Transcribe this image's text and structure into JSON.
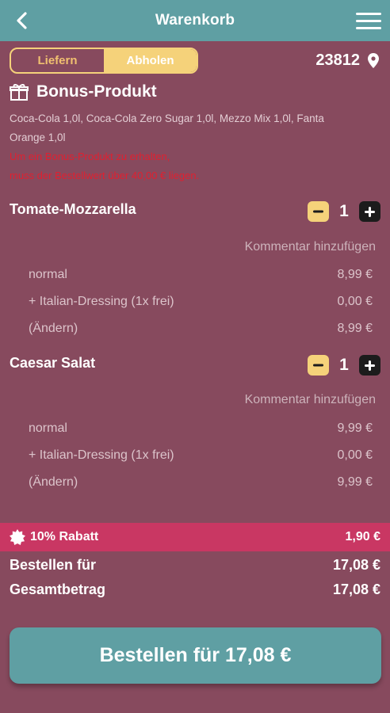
{
  "header": {
    "title": "Warenkorb",
    "back_icon": "chevron-left-icon",
    "menu_icon": "hamburger-menu-icon"
  },
  "delivery_toggle": {
    "options": [
      "Liefern",
      "Abholen"
    ],
    "selected": "Abholen",
    "active_color": "#f5d27a"
  },
  "location": {
    "zip": "23812",
    "icon": "map-pin-icon"
  },
  "bonus": {
    "title": "Bonus-Produkt",
    "icon": "gift-icon",
    "products": "Coca-Cola 1,0l, Coca-Cola Zero Sugar 1,0l, Mezzo Mix 1,0l, Fanta Orange 1,0l",
    "hint_line1": "Um ein Bonus-Produkt zu erhalten,",
    "hint_line2": "muss der Bestellwert über 40,00 € liegen."
  },
  "items": [
    {
      "name": "Tomate-Mozzarella",
      "quantity": "1",
      "comment_label": "Kommentar hinzufügen",
      "lines": [
        {
          "label": "normal",
          "price": "8,99 €"
        },
        {
          "label": "+ Italian-Dressing (1x frei)",
          "price": "0,00 €"
        },
        {
          "label": "(Ändern)",
          "price": "8,99 €"
        }
      ]
    },
    {
      "name": "Caesar Salat",
      "quantity": "1",
      "comment_label": "Kommentar hinzufügen",
      "lines": [
        {
          "label": "normal",
          "price": "9,99 €"
        },
        {
          "label": "+ Italian-Dressing (1x frei)",
          "price": "0,00 €"
        },
        {
          "label": "(Ändern)",
          "price": "9,99 €"
        }
      ]
    }
  ],
  "discount": {
    "label": "10% Rabatt",
    "amount": "1,90 €",
    "icon": "badge-icon",
    "color": "#c93763"
  },
  "totals": {
    "order_label": "Bestellen für",
    "order_value": "17,08 €",
    "grand_label": "Gesamtbetrag",
    "grand_value": "17,08 €"
  },
  "order_button": {
    "label": "Bestellen für 17,08 €"
  },
  "colors": {
    "background": "#874a5e",
    "accent_teal": "#5f9fa3",
    "accent_yellow": "#f5d27a"
  }
}
